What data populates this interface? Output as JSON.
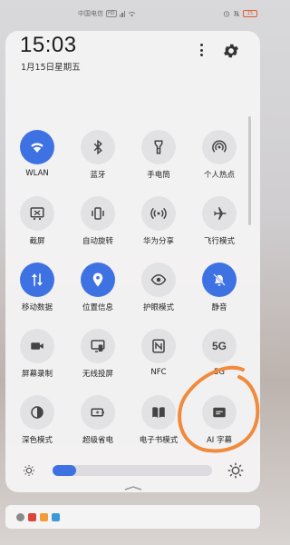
{
  "status_bar": {
    "carrier": "中国电信",
    "network_tag": "HD",
    "battery": "15"
  },
  "panel": {
    "time": "15:03",
    "date": "1月15日星期五"
  },
  "tiles": [
    {
      "label": "WLAN",
      "icon": "wifi-icon",
      "on": true
    },
    {
      "label": "蓝牙",
      "icon": "bluetooth-icon",
      "on": false
    },
    {
      "label": "手电筒",
      "icon": "flashlight-icon",
      "on": false
    },
    {
      "label": "个人热点",
      "icon": "hotspot-icon",
      "on": false
    },
    {
      "label": "截屏",
      "icon": "screenshot-icon",
      "on": false
    },
    {
      "label": "自动旋转",
      "icon": "rotate-icon",
      "on": false
    },
    {
      "label": "华为分享",
      "icon": "share-icon",
      "on": false
    },
    {
      "label": "飞行模式",
      "icon": "airplane-icon",
      "on": false
    },
    {
      "label": "移动数据",
      "icon": "mobile-data-icon",
      "on": true
    },
    {
      "label": "位置信息",
      "icon": "location-icon",
      "on": true
    },
    {
      "label": "护眼模式",
      "icon": "eye-icon",
      "on": false
    },
    {
      "label": "静音",
      "icon": "bell-mute-icon",
      "on": true
    },
    {
      "label": "屏幕录制",
      "icon": "record-icon",
      "on": false
    },
    {
      "label": "无线投屏",
      "icon": "cast-icon",
      "on": false
    },
    {
      "label": "NFC",
      "icon": "nfc-icon",
      "on": false
    },
    {
      "label": "5G",
      "icon": "5g-icon",
      "on": false,
      "icon_text": "5G"
    },
    {
      "label": "深色模式",
      "icon": "dark-mode-icon",
      "on": false
    },
    {
      "label": "超级省电",
      "icon": "battery-saver-icon",
      "on": false
    },
    {
      "label": "电子书模式",
      "icon": "ebook-icon",
      "on": false
    },
    {
      "label": "AI 字幕",
      "icon": "ai-subtitle-icon",
      "on": false
    }
  ],
  "brightness": {
    "level": 0.15
  },
  "colors": {
    "accent": "#3e72e3",
    "annotation": "#f08a3c"
  }
}
